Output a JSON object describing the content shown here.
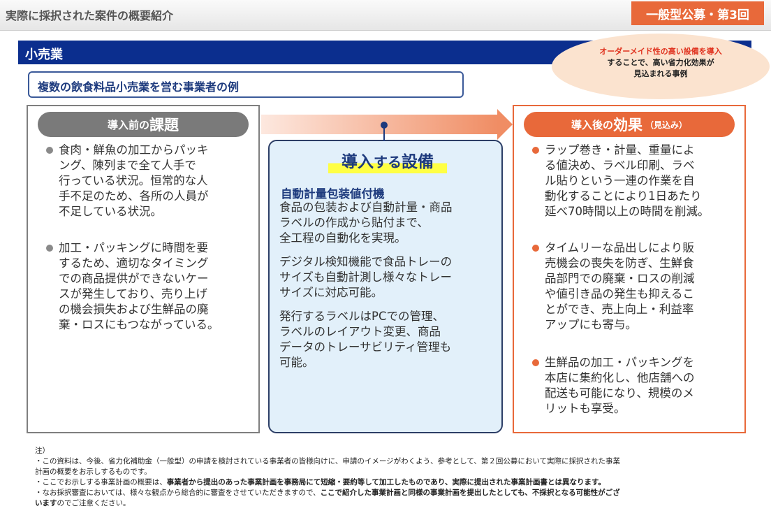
{
  "header": {
    "title": "実際に採択された案件の概要紹介",
    "badge": "一般型公募・第3回"
  },
  "band": {
    "title": "小売業"
  },
  "bubble": {
    "line1_red": "オーダーメイド性の高い設備を導入",
    "line2": "することで、高い省力化効果が",
    "line3": "見込まれる事例"
  },
  "subtitle": "複数の飲食料品小売業を営む事業者の例",
  "before": {
    "pill_small": "導入前の",
    "pill_large": "課題",
    "bullets": [
      [
        "食肉・鮮魚の加工からパッキ",
        "ング、陳列まで全て人手で",
        "行っている状況。恒常的な人",
        "手不足のため、各所の人員が",
        "不足している状況。"
      ],
      [
        "加工・パッキングに時間を要",
        "するため、適切なタイミング",
        "での商品提供ができないケー",
        "スが発生しており、売り上げ",
        "の機会損失および生鮮品の廃",
        "棄・ロスにもつながっている。"
      ]
    ]
  },
  "equipment": {
    "title_a": "導入",
    "title_b": "する",
    "title_c": "設備",
    "name": "自動計量包装値付機",
    "paragraphs": [
      [
        "食品の包装および自動計量・商品",
        "ラベルの作成から貼付まで、",
        "全工程の自動化を実現。"
      ],
      [
        "デジタル検知機能で食品トレーの",
        "サイズも自動計測し様々なトレー",
        "サイズに対応可能。"
      ],
      [
        "発行するラベルはPCでの管理、",
        "ラベルのレイアウト変更、商品",
        "データのトレーサビリティ管理も",
        "可能。"
      ]
    ]
  },
  "after": {
    "pill_small": "導入後の",
    "pill_large": "効果",
    "pill_note": "（見込み）",
    "bullets": [
      [
        "ラップ巻き・計量、重量によ",
        "る値決め、ラベル印刷、ラベ",
        "ル貼りという一連の作業を自",
        "動化することにより1日あたり",
        "延べ70時間以上の時間を削減。"
      ],
      [
        "タイムリーな品出しにより販",
        "売機会の喪失を防ぎ、生鮮食",
        "品部門での廃棄・ロスの削減",
        "や値引き品の発生も抑えるこ",
        "とができ、売上向上・利益率",
        "アップにも寄与。"
      ],
      [
        "生鮮品の加工・パッキングを",
        "本店に集約化し、他店舗への",
        "配送も可能になり、規模のメ",
        "リットも享受。"
      ]
    ]
  },
  "notes": {
    "heading": "注）",
    "line1": "・この資料は、今後、省力化補助金（一般型）の申請を検討されている事業者の皆様向けに、申請のイメージがわくよう、参考として、第２回公募において実際に採択された事業",
    "line1b": "計画の概要をお示しするものです。",
    "line2a": "・ここでお示しする事業計画の概要は、",
    "line2b": "事業者から提出のあった事業計画を事務局にて短縮・要約等して加工したものであり、実際に提出された事業計画書とは異なります。",
    "line3a": "・なお採択審査においては、様々な観点から総合的に審査をさせていただきますので、",
    "line3b": "ここで紹介した事業計画と同様の事業計画を提出したとしても、不採択となる可能性がござ",
    "line3c": "います",
    "line3d": "のでご注意ください。"
  }
}
